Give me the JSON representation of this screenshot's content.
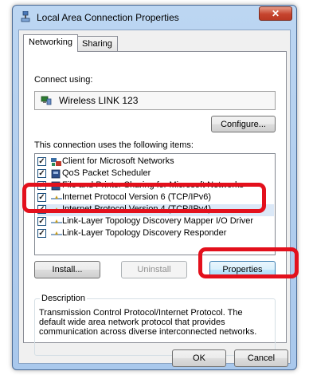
{
  "window": {
    "title": "Local Area Connection Properties",
    "close_glyph": "✕",
    "title_icon": "network-connection-icon"
  },
  "tabs": [
    {
      "label": "Networking",
      "active": true
    },
    {
      "label": "Sharing",
      "active": false
    }
  ],
  "connect_using": {
    "label": "Connect using:",
    "adapter_name": "Wireless LINK 123",
    "adapter_icon": "network-adapter-icon",
    "configure_label": "Configure..."
  },
  "items_section": {
    "label": "This connection uses the following items:",
    "items": [
      {
        "label": "Client for Microsoft Networks",
        "checked": true,
        "icon": "client-icon"
      },
      {
        "label": "QoS Packet Scheduler",
        "checked": true,
        "icon": "service-icon"
      },
      {
        "label": "File and Printer Sharing for Microsoft Networks",
        "checked": true,
        "icon": "service-icon"
      },
      {
        "label": "Internet Protocol Version 6 (TCP/IPv6)",
        "checked": true,
        "icon": "protocol-icon"
      },
      {
        "label": "Internet Protocol Version 4 (TCP/IPv4)",
        "checked": true,
        "icon": "protocol-icon"
      },
      {
        "label": "Link-Layer Topology Discovery Mapper I/O Driver",
        "checked": true,
        "icon": "protocol-icon"
      },
      {
        "label": "Link-Layer Topology Discovery Responder",
        "checked": true,
        "icon": "protocol-icon"
      }
    ]
  },
  "actions": {
    "install": "Install...",
    "uninstall": "Uninstall",
    "properties": "Properties"
  },
  "description": {
    "title": "Description",
    "text": "Transmission Control Protocol/Internet Protocol. The default wide area network protocol that provides communication across diverse interconnected networks."
  },
  "footer": {
    "ok": "OK",
    "cancel": "Cancel"
  },
  "colors": {
    "highlight": "#e3101c",
    "title_bar": "#bcd6f2",
    "close_button": "#c6442e"
  }
}
